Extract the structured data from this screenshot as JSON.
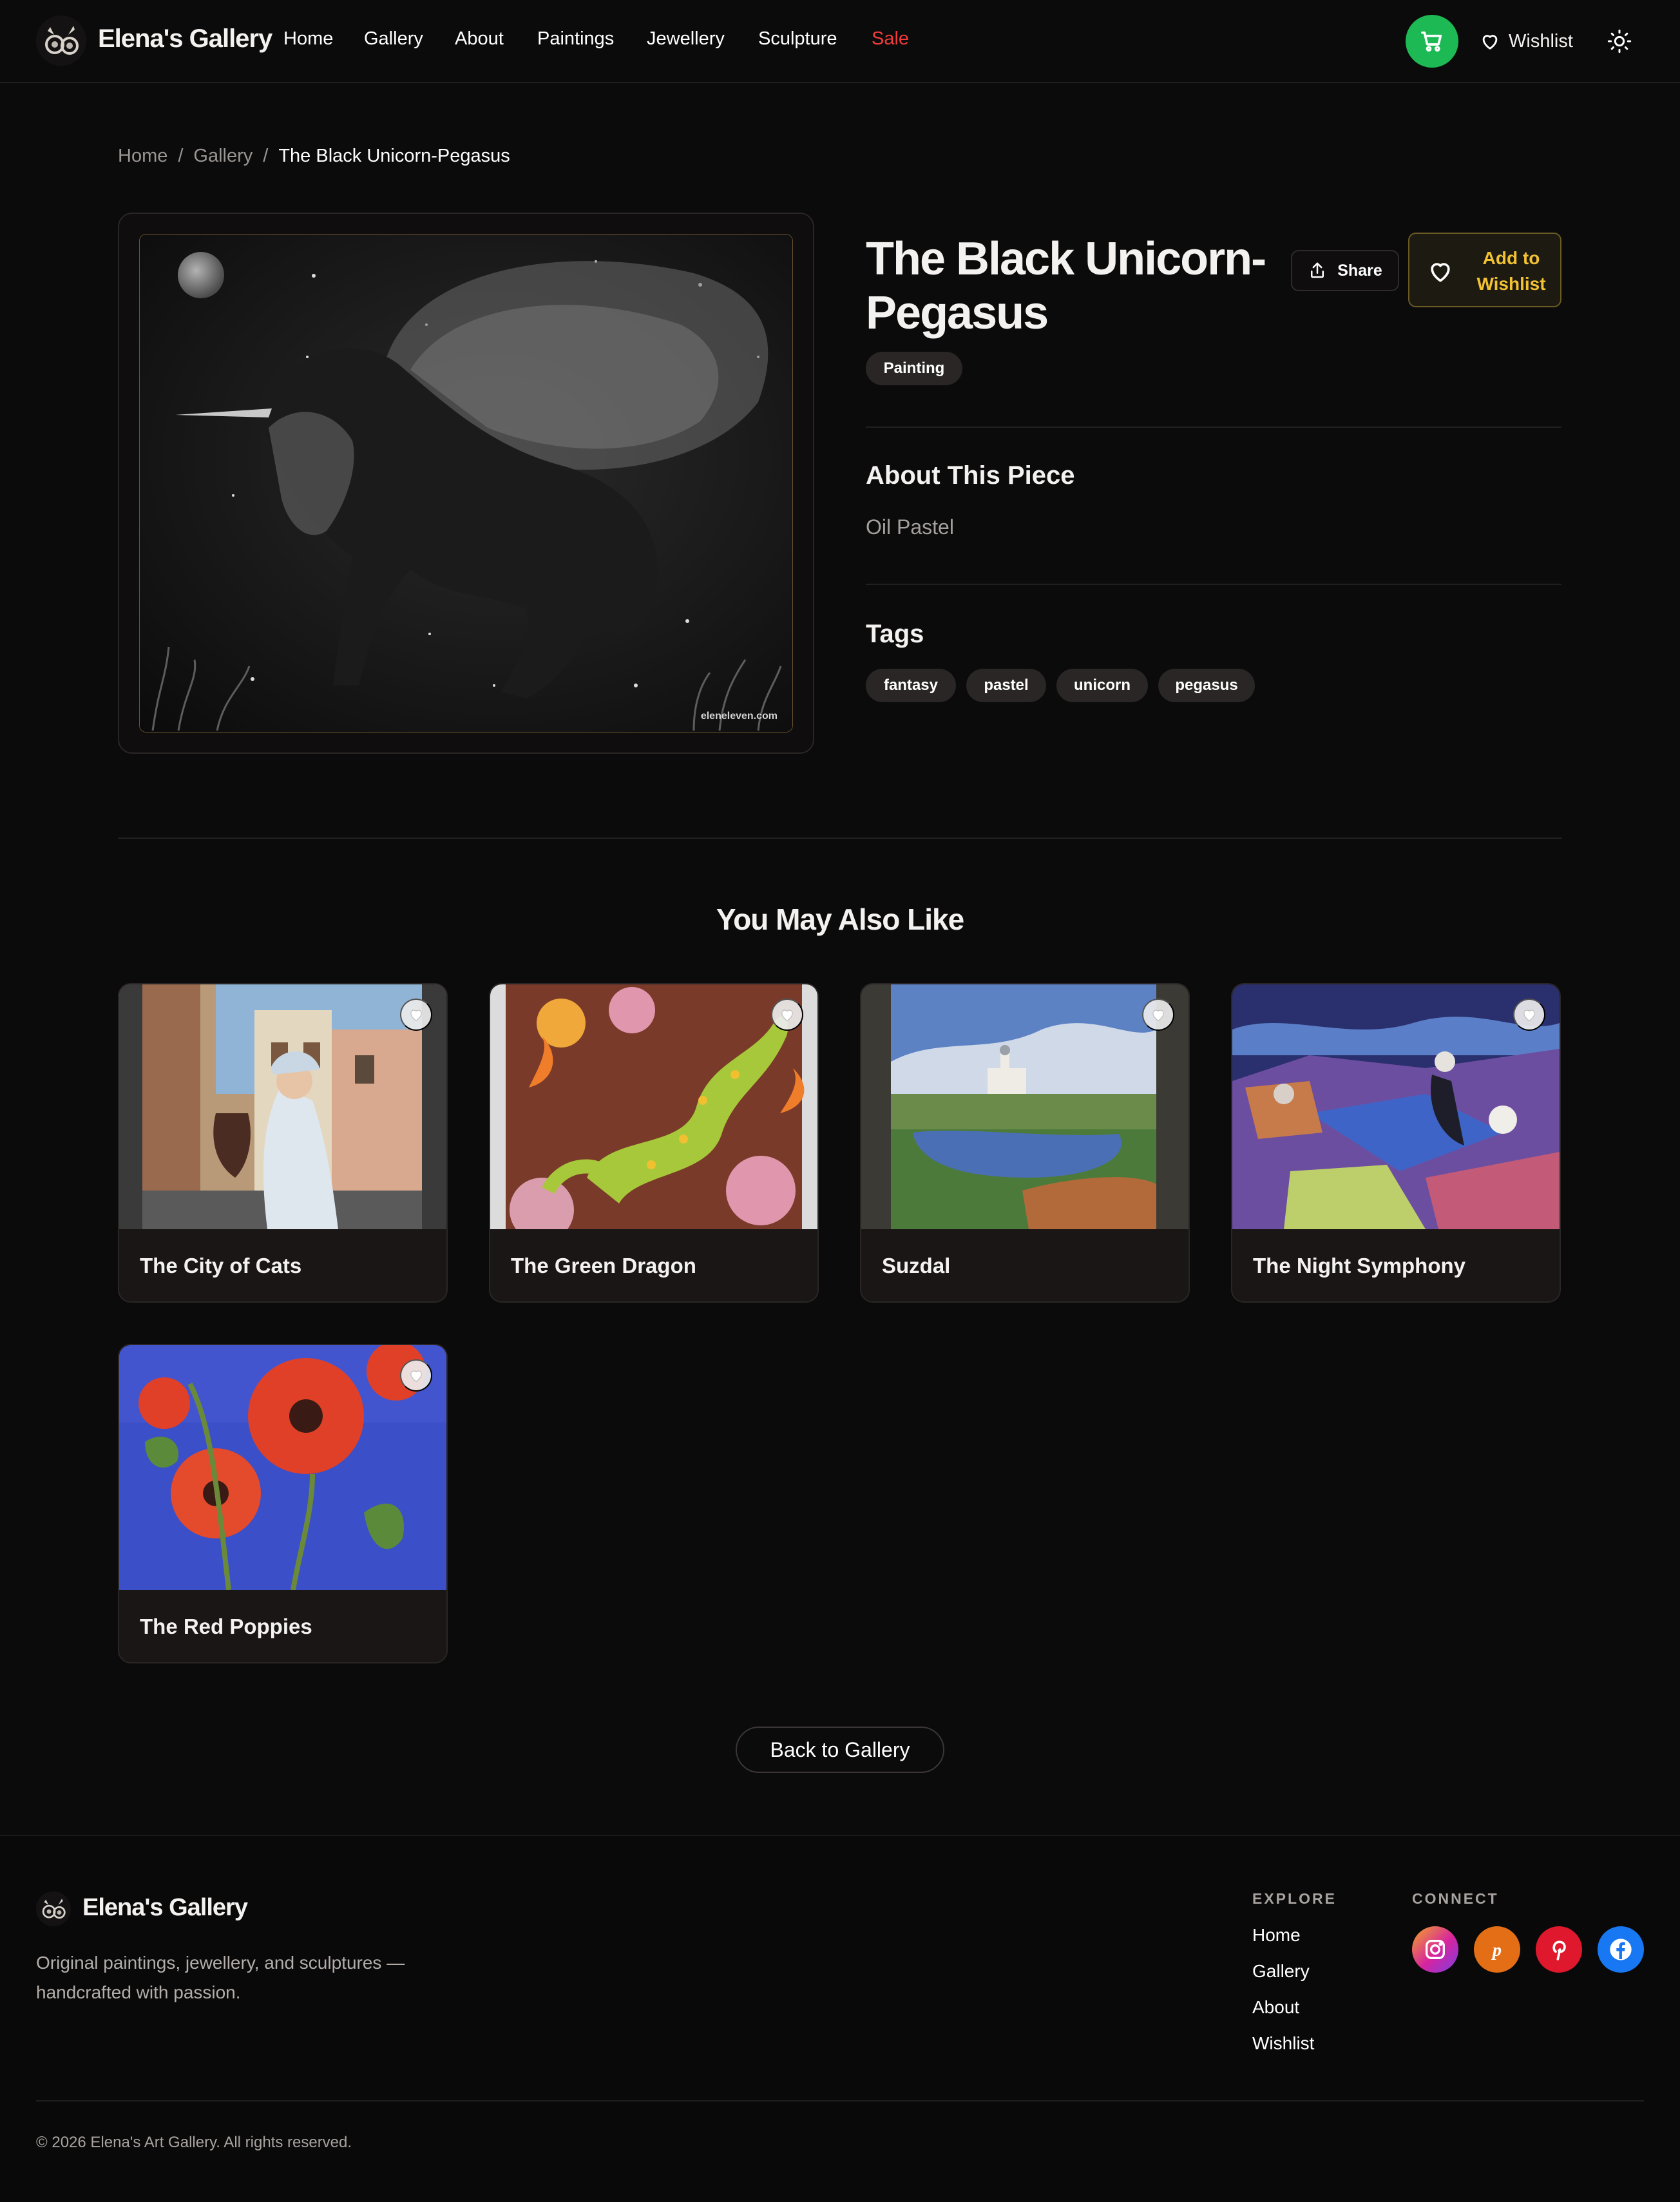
{
  "header": {
    "brand": "Elena's Gallery",
    "nav": [
      "Home",
      "Gallery",
      "About",
      "Paintings",
      "Jewellery",
      "Sculpture",
      "Sale"
    ],
    "wishlist_label": "Wishlist",
    "icons": [
      "logo-icon",
      "cart-icon",
      "heart-icon",
      "sun-icon"
    ],
    "colors": {
      "cart": "#1db954",
      "sale": "#ef3b3b"
    }
  },
  "breadcrumb": {
    "home": "Home",
    "sep1": "/",
    "gallery": "Gallery",
    "sep2": "/",
    "current": "The Black Unicorn-Pegasus"
  },
  "artwork": {
    "title": "The Black Unicorn-Pegasus",
    "category": "Painting",
    "share_label": "Share",
    "wishlist_label": "Add to Wishlist",
    "about_heading": "About This Piece",
    "medium": "Oil Pastel",
    "tags_heading": "Tags",
    "tags": [
      "fantasy",
      "pastel",
      "unicorn",
      "pegasus"
    ],
    "watermark": "eleneleven.com",
    "accent": "#f2c233"
  },
  "related": {
    "heading": "You May Also Like",
    "items": [
      {
        "title": "The City of Cats"
      },
      {
        "title": "The Green Dragon"
      },
      {
        "title": "Suzdal"
      },
      {
        "title": "The Night Symphony"
      },
      {
        "title": "The Red Poppies"
      }
    ]
  },
  "back_label": "Back to Gallery",
  "footer": {
    "brand": "Elena's Gallery",
    "description": "Original paintings, jewellery, and sculptures — handcrafted with passion.",
    "explore_heading": "EXPLORE",
    "explore_links": [
      "Home",
      "Gallery",
      "About",
      "Wishlist"
    ],
    "connect_heading": "CONNECT",
    "social": [
      "instagram-icon",
      "etsy-icon",
      "pinterest-icon",
      "facebook-icon"
    ],
    "copyright": "© 2026 Elena's Art Gallery. All rights reserved."
  }
}
